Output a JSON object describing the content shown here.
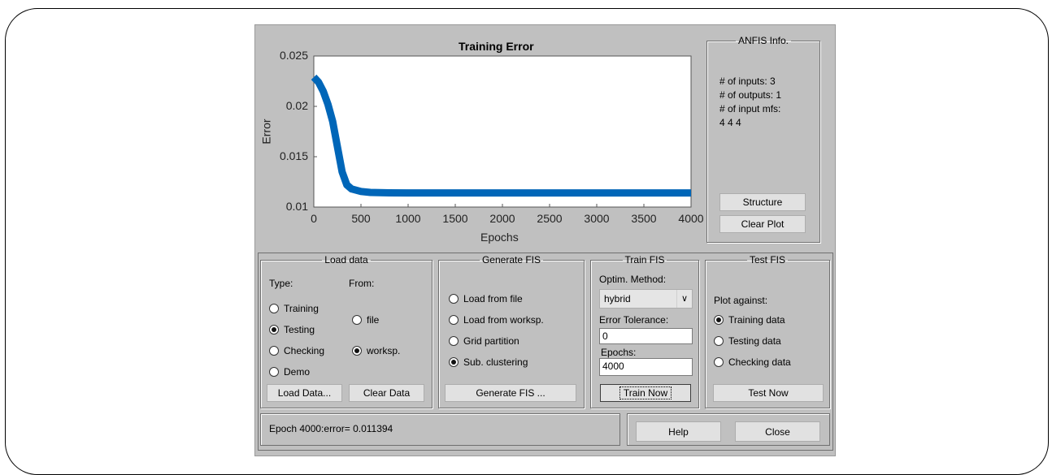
{
  "plot": {
    "title": "Training Error",
    "ylabel": "Error",
    "xlabel": "Epochs",
    "yticks": [
      "0.025",
      "0.02",
      "0.015",
      "0.01"
    ],
    "xticks": [
      "0",
      "500",
      "1000",
      "1500",
      "2000",
      "2500",
      "3000",
      "3500",
      "4000"
    ],
    "line_color": "#0066b8"
  },
  "chart_data": {
    "type": "line",
    "title": "Training Error",
    "xlabel": "Epochs",
    "ylabel": "Error",
    "xlim": [
      0,
      4000
    ],
    "ylim": [
      0.01,
      0.025
    ],
    "series": [
      {
        "x": [
          0,
          50,
          100,
          150,
          200,
          250,
          300,
          350,
          400,
          500,
          600,
          800,
          1000,
          1500,
          2000,
          2500,
          3000,
          3500,
          4000
        ],
        "y": [
          0.0229,
          0.0224,
          0.0215,
          0.0202,
          0.0185,
          0.016,
          0.0135,
          0.0122,
          0.0118,
          0.01155,
          0.01145,
          0.01141,
          0.0114,
          0.0114,
          0.0114,
          0.0114,
          0.0114,
          0.0114,
          0.0114
        ]
      }
    ]
  },
  "anfis_info": {
    "legend": "ANFIS Info.",
    "inputs": "# of inputs: 3",
    "outputs": "# of outputs: 1",
    "input_mfs": "# of input mfs:",
    "mfs_values": "4  4  4",
    "structure_button": "Structure",
    "clear_plot_button": "Clear Plot"
  },
  "load_data": {
    "legend": "Load data",
    "type_label": "Type:",
    "from_label": "From:",
    "types": [
      "Training",
      "Testing",
      "Checking",
      "Demo"
    ],
    "type_selected": "Testing",
    "sources": [
      "file",
      "worksp."
    ],
    "source_selected": "worksp.",
    "load_button": "Load Data...",
    "clear_button": "Clear Data"
  },
  "generate_fis": {
    "legend": "Generate FIS",
    "options": [
      "Load from file",
      "Load from worksp.",
      "Grid partition",
      "Sub. clustering"
    ],
    "selected": "Sub. clustering",
    "button": "Generate FIS ..."
  },
  "train_fis": {
    "legend": "Train FIS",
    "optim_label": "Optim. Method:",
    "optim_value": "hybrid",
    "error_tol_label": "Error Tolerance:",
    "error_tol_value": "0",
    "epochs_label": "Epochs:",
    "epochs_value": "4000",
    "button": "Train Now"
  },
  "test_fis": {
    "legend": "Test FIS",
    "plot_against_label": "Plot against:",
    "options": [
      "Training data",
      "Testing data",
      "Checking data"
    ],
    "selected": "Training data",
    "button": "Test Now"
  },
  "status": {
    "message": "Epoch 4000:error= 0.011394",
    "help_button": "Help",
    "close_button": "Close"
  }
}
